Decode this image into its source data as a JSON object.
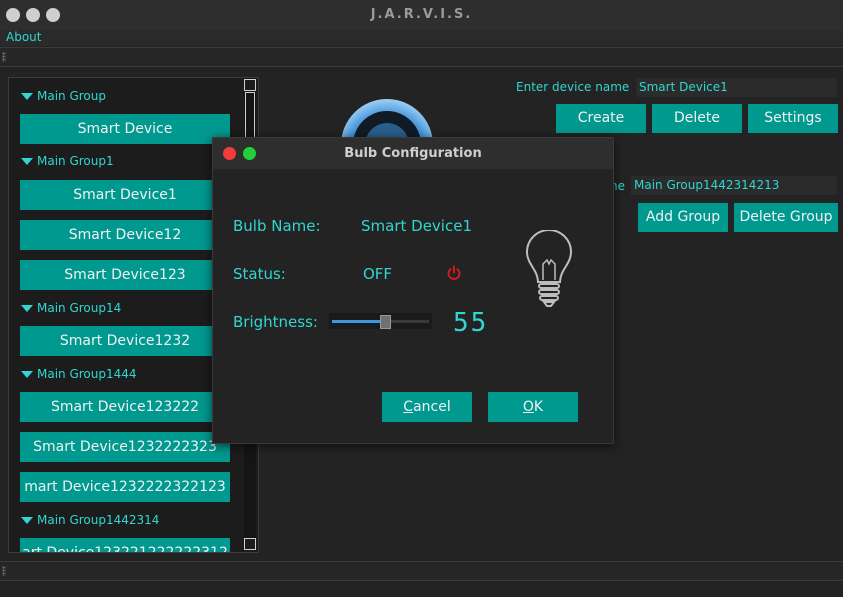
{
  "window": {
    "title": "J.A.R.V.I.S."
  },
  "menu": {
    "about": "About"
  },
  "device_panel": {
    "enter_device_label": "Enter device name",
    "device_name_value": "Smart Device1",
    "create_label": "Create",
    "delete_label": "Delete",
    "settings_label": "Settings",
    "group_label_fragment": "ne",
    "group_name_value": "Main Group1442314213",
    "add_group_label": "Add Group",
    "delete_group_label": "Delete Group"
  },
  "tree": {
    "groups": [
      {
        "name": "Main Group"
      },
      {
        "name": "Main Group1"
      },
      {
        "name": "Main Group14"
      },
      {
        "name": "Main Group1444"
      },
      {
        "name": "Main Group1442314"
      }
    ],
    "devices": [
      {
        "label": "Smart Device"
      },
      {
        "label": "Smart Device1"
      },
      {
        "label": "Smart Device12"
      },
      {
        "label": "Smart Device123"
      },
      {
        "label": "Smart Device1232"
      },
      {
        "label": "Smart Device123222"
      },
      {
        "label": "Smart Device1232222323"
      },
      {
        "label": "mart Device1232222322123"
      },
      {
        "label": "art Device123221222222312"
      }
    ]
  },
  "dialog": {
    "title": "Bulb Configuration",
    "bulb_name_label": "Bulb Name:",
    "bulb_name_value": "Smart Device1",
    "status_label": "Status:",
    "status_value": "OFF",
    "brightness_label": "Brightness:",
    "brightness_value": "55",
    "brightness_fraction": 0.55,
    "cancel_rest": "ancel",
    "cancel_mnemonic": "C",
    "ok_mnemonic": "O",
    "ok_rest": "K"
  },
  "colors": {
    "accent": "#00998f",
    "text_accent": "#2fd7d0",
    "background": "#232323",
    "power_off": "#d11a1a"
  },
  "icons": {
    "bulb": "lightbulb-icon",
    "power": "power-icon",
    "expand": "triangle-down-icon",
    "lens": "camera-lens-icon"
  }
}
